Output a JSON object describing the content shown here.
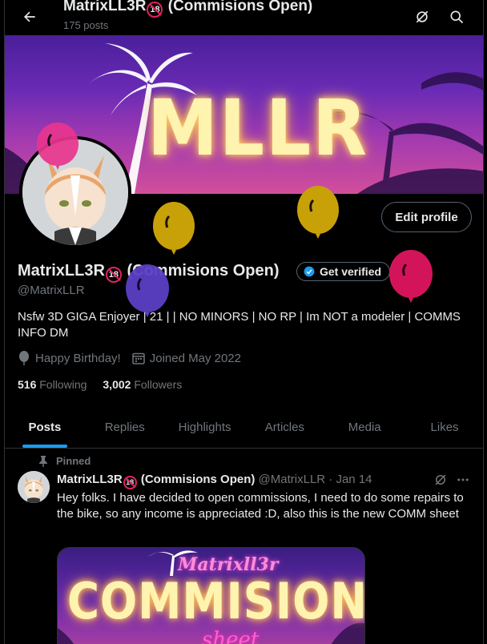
{
  "header": {
    "title_prefix": "MatrixLL3R",
    "badge": "18",
    "title_suffix": "(Commisions Open)",
    "post_count": "175 posts",
    "back_icon": "back-arrow-icon",
    "grok_icon": "grok-icon",
    "search_icon": "search-icon"
  },
  "banner": {
    "text": "MLLR"
  },
  "profile": {
    "name_prefix": "MatrixLL3R",
    "badge": "18",
    "name_suffix": "(Commisions Open)",
    "get_verified_label": "Get verified",
    "handle": "@MatrixLLR",
    "bio": "Nsfw 3D GIGA Enjoyer | 21 | | NO MINORS | NO RP | Im NOT a modeler | COMMS INFO DM",
    "birthday": "Happy Birthday!",
    "joined": "Joined May 2022",
    "following_count": "516",
    "following_label": "Following",
    "followers_count": "3,002",
    "followers_label": "Followers",
    "edit_profile_label": "Edit profile"
  },
  "tabs": [
    {
      "label": "Posts"
    },
    {
      "label": "Replies"
    },
    {
      "label": "Highlights"
    },
    {
      "label": "Articles"
    },
    {
      "label": "Media"
    },
    {
      "label": "Likes"
    }
  ],
  "tweet": {
    "pinned_label": "Pinned",
    "name_prefix": "MatrixLL3R",
    "badge": "18",
    "name_suffix": "(Commisions Open)",
    "handle": "@MatrixLLR",
    "dot": "·",
    "date": "Jan 14",
    "text": "Hey folks. I have decided to open commissions, I need to do some repairs to the bike, so any income is appreciated :D, also this is the new COMM sheet",
    "media_small": "Matrixll3r",
    "media_big": "COMMISION",
    "media_sub": "sheet"
  },
  "colors": {
    "accent": "#1d9bf0",
    "background": "#000000",
    "text": "#e7e9ea",
    "muted": "#71767b",
    "border": "#2f3336"
  }
}
